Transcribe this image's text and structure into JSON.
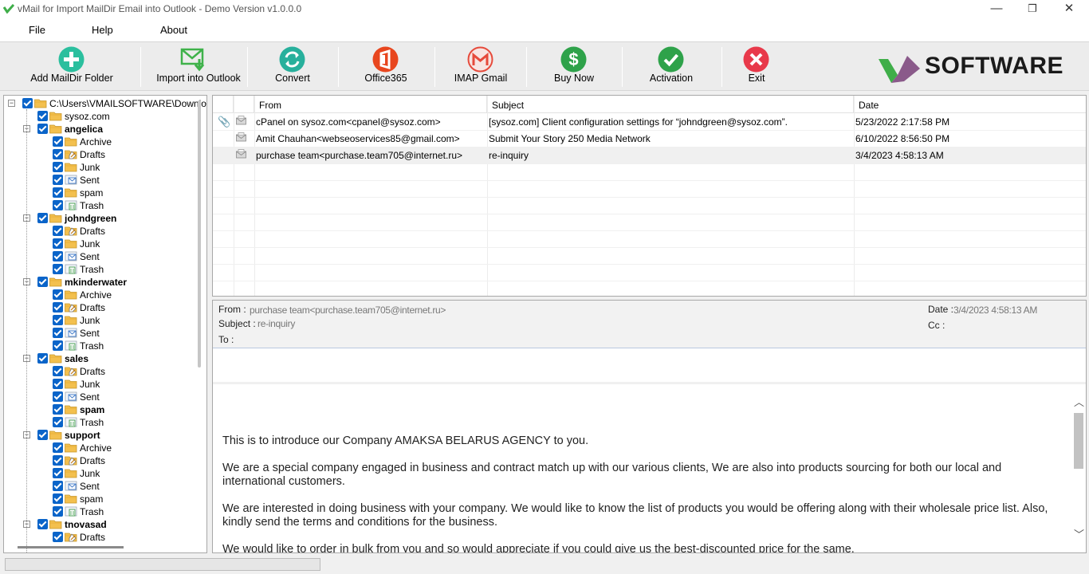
{
  "window": {
    "title": "vMail for Import MailDir Email into Outlook - Demo Version v1.0.0.0",
    "minimize": "—",
    "restore": "❐",
    "close": "✕"
  },
  "menu": [
    "File",
    "Help",
    "About"
  ],
  "toolbar": {
    "buttons": [
      {
        "label": "Add MailDir Folder",
        "icon": "plus-icon",
        "color": "#2bbf9e"
      },
      {
        "label": "Import into Outlook",
        "icon": "email-import-icon",
        "color": "#3fb24a"
      },
      {
        "label": "Convert",
        "icon": "convert-icon",
        "color": "#27b09c"
      },
      {
        "label": "Office365",
        "icon": "office365-icon",
        "color": "#e8461e"
      },
      {
        "label": "IMAP Gmail",
        "icon": "gmail-icon",
        "color": "#e64a3b"
      },
      {
        "label": "Buy Now",
        "icon": "dollar-icon",
        "color": "#2ea24a"
      },
      {
        "label": "Activation",
        "icon": "check-icon",
        "color": "#2ea24a"
      },
      {
        "label": "Exit",
        "icon": "close-icon",
        "color": "#e8394a"
      }
    ],
    "brand": "SOFTWARE",
    "brand_colors": [
      "#3fae49",
      "#8a5a8a"
    ]
  },
  "tree": {
    "root": "C:\\Users\\VMAILSOFTWARE\\Downlo...",
    "items": [
      {
        "label": "sysoz.com",
        "level": 1,
        "bold": false,
        "expander": false,
        "icon": "folder"
      },
      {
        "label": "angelica",
        "level": 1,
        "bold": true,
        "expander": true,
        "icon": "folder"
      },
      {
        "label": "Archive",
        "level": 2,
        "bold": false,
        "icon": "folder"
      },
      {
        "label": "Drafts",
        "level": 2,
        "bold": false,
        "icon": "drafts"
      },
      {
        "label": "Junk",
        "level": 2,
        "bold": false,
        "icon": "folder"
      },
      {
        "label": "Sent",
        "level": 2,
        "bold": false,
        "icon": "sent"
      },
      {
        "label": "spam",
        "level": 2,
        "bold": false,
        "icon": "folder"
      },
      {
        "label": "Trash",
        "level": 2,
        "bold": false,
        "icon": "trash"
      },
      {
        "label": "johndgreen",
        "level": 1,
        "bold": true,
        "expander": true,
        "icon": "folder"
      },
      {
        "label": "Drafts",
        "level": 2,
        "bold": false,
        "icon": "drafts"
      },
      {
        "label": "Junk",
        "level": 2,
        "bold": false,
        "icon": "folder"
      },
      {
        "label": "Sent",
        "level": 2,
        "bold": false,
        "icon": "sent"
      },
      {
        "label": "Trash",
        "level": 2,
        "bold": false,
        "icon": "trash"
      },
      {
        "label": "mkinderwater",
        "level": 1,
        "bold": true,
        "expander": true,
        "icon": "folder"
      },
      {
        "label": "Archive",
        "level": 2,
        "bold": false,
        "icon": "folder"
      },
      {
        "label": "Drafts",
        "level": 2,
        "bold": false,
        "icon": "drafts"
      },
      {
        "label": "Junk",
        "level": 2,
        "bold": false,
        "icon": "folder"
      },
      {
        "label": "Sent",
        "level": 2,
        "bold": false,
        "icon": "sent"
      },
      {
        "label": "Trash",
        "level": 2,
        "bold": false,
        "icon": "trash"
      },
      {
        "label": "sales",
        "level": 1,
        "bold": true,
        "expander": true,
        "icon": "folder"
      },
      {
        "label": "Drafts",
        "level": 2,
        "bold": false,
        "icon": "drafts"
      },
      {
        "label": "Junk",
        "level": 2,
        "bold": false,
        "icon": "folder"
      },
      {
        "label": "Sent",
        "level": 2,
        "bold": false,
        "icon": "sent"
      },
      {
        "label": "spam",
        "level": 2,
        "bold": true,
        "icon": "folder"
      },
      {
        "label": "Trash",
        "level": 2,
        "bold": false,
        "icon": "trash"
      },
      {
        "label": "support",
        "level": 1,
        "bold": true,
        "expander": true,
        "icon": "folder"
      },
      {
        "label": "Archive",
        "level": 2,
        "bold": false,
        "icon": "folder"
      },
      {
        "label": "Drafts",
        "level": 2,
        "bold": false,
        "icon": "drafts"
      },
      {
        "label": "Junk",
        "level": 2,
        "bold": false,
        "icon": "folder"
      },
      {
        "label": "Sent",
        "level": 2,
        "bold": false,
        "icon": "sent"
      },
      {
        "label": "spam",
        "level": 2,
        "bold": false,
        "icon": "folder"
      },
      {
        "label": "Trash",
        "level": 2,
        "bold": false,
        "icon": "trash"
      },
      {
        "label": "tnovasad",
        "level": 1,
        "bold": true,
        "expander": true,
        "icon": "folder"
      },
      {
        "label": "Drafts",
        "level": 2,
        "bold": false,
        "icon": "drafts"
      }
    ]
  },
  "grid": {
    "columns": [
      "From",
      "Subject",
      "Date"
    ],
    "rows": [
      {
        "attachment": true,
        "from": "cPanel on sysoz.com<cpanel@sysoz.com>",
        "subject": "[sysoz.com] Client configuration settings for “johndgreen@sysoz.com”.",
        "date": "5/23/2022 2:17:58 PM"
      },
      {
        "attachment": false,
        "from": "Amit Chauhan<webseoservices85@gmail.com>",
        "subject": "Submit Your Story 250 Media Network",
        "date": "6/10/2022 8:56:50 PM"
      },
      {
        "attachment": false,
        "from": "purchase  team<purchase.team705@internet.ru>",
        "subject": "re-inquiry",
        "date": "3/4/2023 4:58:13 AM"
      }
    ]
  },
  "preview": {
    "from_label": "From :",
    "from_value": "purchase  team<purchase.team705@internet.ru>",
    "subject_label": "Subject :",
    "subject_value": "re-inquiry",
    "to_label": "To :",
    "date_label": "Date :",
    "date_value": "3/4/2023 4:58:13 AM",
    "cc_label": "Cc :",
    "body": [
      "This is to introduce our Company AMAKSA BELARUS AGENCY to you.",
      " We are a special company engaged in business and contract match up with our various clients, We are also into products sourcing for both our local and international customers.",
      "We are interested in doing business with your company. We would like to know the list of products you would be offering along with their wholesale price list. Also, kindly send the terms and conditions for the business.",
      "We would like to order in bulk from you and so would appreciate if you could give us the best-discounted price for the same."
    ]
  }
}
